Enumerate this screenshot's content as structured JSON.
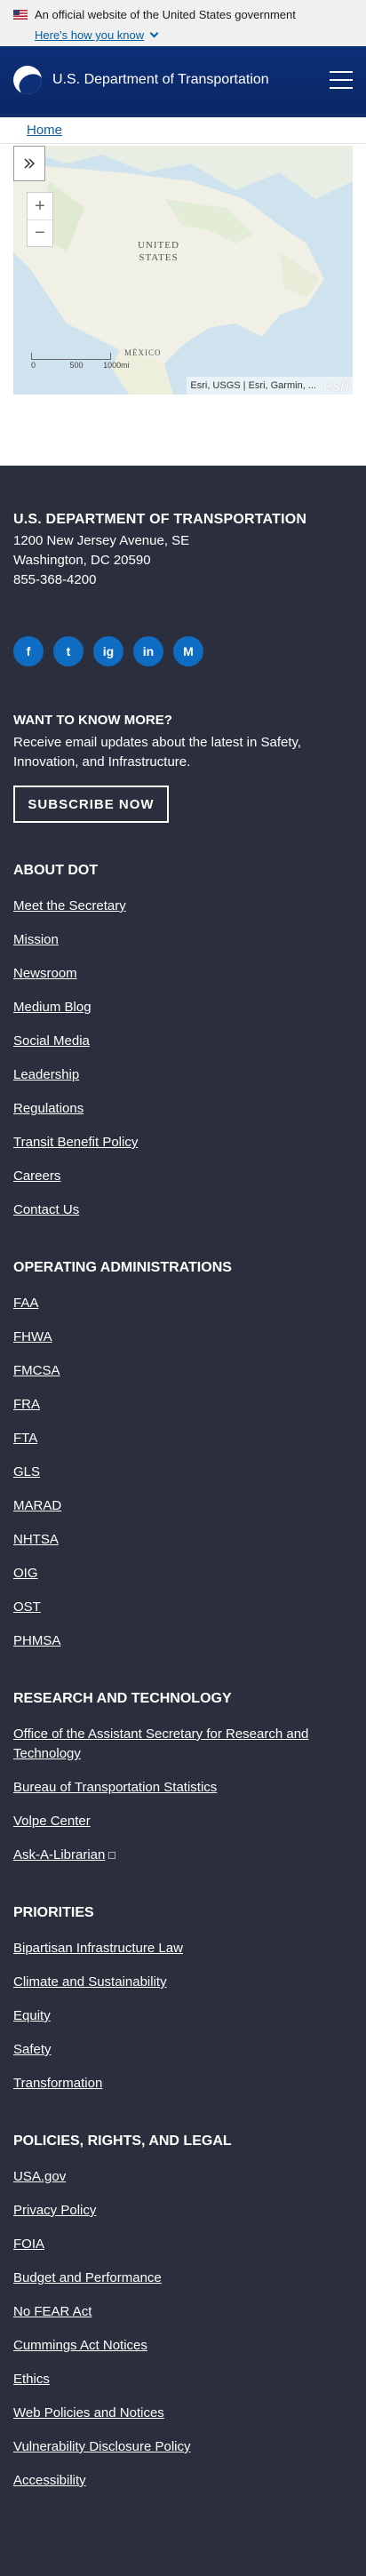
{
  "gov_banner": {
    "text": "An official website of the United States government",
    "link": "Here's how you know"
  },
  "header": {
    "title": "U.S. Department of Transportation"
  },
  "breadcrumb": {
    "home": "Home"
  },
  "map": {
    "label_us_1": "UNITED",
    "label_us_2": "STATES",
    "label_mexico": "MÉXICO",
    "scale_0": "0",
    "scale_500": "500",
    "scale_1000": "1000mi",
    "attribution": "Esri, USGS | Esri, Garmin, ...",
    "esri": "esri"
  },
  "footer": {
    "org": "U.S. DEPARTMENT OF TRANSPORTATION",
    "address_1": "1200 New Jersey Avenue, SE",
    "address_2": "Washington, DC 20590",
    "phone": "855-368-4200",
    "socials": [
      "f",
      "t",
      "ig",
      "in",
      "M"
    ],
    "know_title": "WANT TO KNOW MORE?",
    "know_text": "Receive email updates about the latest in Safety, Innovation, and Infrastructure.",
    "subscribe": "SUBSCRIBE NOW",
    "about": {
      "title": "ABOUT DOT",
      "links": [
        "Meet the Secretary",
        "Mission",
        "Newsroom",
        "Medium Blog",
        "Social Media",
        "Leadership",
        "Regulations",
        "Transit Benefit Policy",
        "Careers",
        "Contact Us"
      ]
    },
    "opadmins": {
      "title": "OPERATING ADMINISTRATIONS",
      "links": [
        "FAA",
        "FHWA",
        "FMCSA",
        "FRA",
        "FTA",
        "GLS",
        "MARAD",
        "NHTSA",
        "OIG",
        "OST",
        "PHMSA"
      ]
    },
    "research": {
      "title": "RESEARCH AND TECHNOLOGY",
      "links": [
        "Office of the Assistant Secretary for Research and Technology",
        "Bureau of Transportation Statistics",
        "Volpe Center",
        "Ask-A-Librarian"
      ]
    },
    "priorities": {
      "title": "PRIORITIES",
      "links": [
        "Bipartisan Infrastructure Law",
        "Climate and Sustainability",
        "Equity",
        "Safety",
        "Transformation"
      ]
    },
    "policies": {
      "title": "POLICIES, RIGHTS, AND LEGAL",
      "links": [
        "USA.gov",
        "Privacy Policy",
        "FOIA",
        "Budget and Performance",
        "No FEAR Act",
        "Cummings Act Notices",
        "Ethics",
        "Web Policies and Notices",
        "Vulnerability Disclosure Policy",
        "Accessibility"
      ]
    }
  }
}
